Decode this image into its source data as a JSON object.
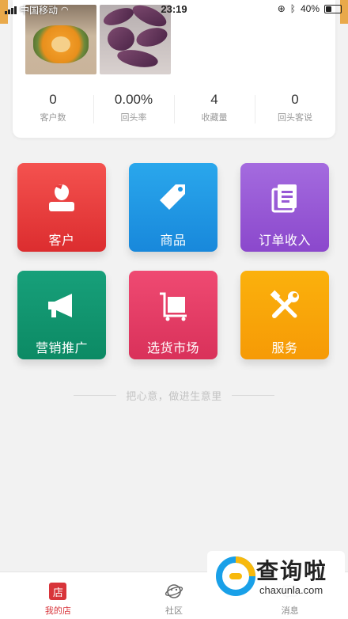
{
  "status_bar": {
    "carrier": "中国移动",
    "time": "23:19",
    "battery": "40%",
    "battery_level": 0.4
  },
  "stats": [
    {
      "value": "0",
      "label": "客户数"
    },
    {
      "value": "0.00%",
      "label": "回头率"
    },
    {
      "value": "4",
      "label": "收藏量"
    },
    {
      "value": "0",
      "label": "回头客说"
    }
  ],
  "tiles": [
    {
      "label": "客户",
      "icon": "customer-icon",
      "color": "#e83a3c"
    },
    {
      "label": "商品",
      "icon": "tag-icon",
      "color": "#1f98e4"
    },
    {
      "label": "订单收入",
      "icon": "document-icon",
      "color": "#9759d5"
    },
    {
      "label": "营销推广",
      "icon": "megaphone-icon",
      "color": "#12956f"
    },
    {
      "label": "选货市场",
      "icon": "cart-icon",
      "color": "#e33d66"
    },
    {
      "label": "服务",
      "icon": "tools-icon",
      "color": "#f8a509"
    }
  ],
  "slogan": "把心意，做进生意里",
  "tab_bar": {
    "items": [
      {
        "label": "我的店",
        "glyph": "店",
        "icon": "store-icon",
        "active": true
      },
      {
        "label": "社区",
        "icon": "planet-icon",
        "active": false
      },
      {
        "label": "消息",
        "icon": "message-icon",
        "active": false
      }
    ]
  },
  "watermark": {
    "text": "查询啦",
    "url": "chaxunla.com"
  },
  "colors": {
    "accent": "#d8343a",
    "background": "#f2f2f2"
  }
}
